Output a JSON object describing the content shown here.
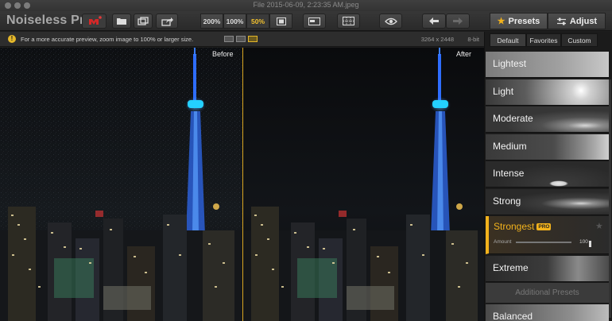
{
  "window": {
    "title": "File 2015-06-09, 2:23:35 AM.jpeg"
  },
  "toolbar": {
    "app_name": "Noiseless Pro",
    "zoom_buttons": [
      "200%",
      "100%",
      "50%"
    ],
    "active_zoom": "50%",
    "presets_tab": "Presets",
    "adjust_tab": "Adjust"
  },
  "infobar": {
    "message": "For a more accurate preview, zoom image to 100% or larger size.",
    "dimensions": "3264 x 2448",
    "bit_depth": "8-bit"
  },
  "preview": {
    "before_label": "Before",
    "after_label": "After"
  },
  "panel": {
    "tabs": [
      "Default",
      "Favorites",
      "Custom"
    ],
    "active_tab": "Default",
    "presets": [
      "Lightest",
      "Light",
      "Moderate",
      "Medium",
      "Intense",
      "Strong",
      "Strongest",
      "Extreme"
    ],
    "selected_preset": "Strongest",
    "pro_badge": "PRO",
    "amount_label": "Amount",
    "amount_value": "100",
    "additional_header": "Additional Presets",
    "additional_presets": [
      "Balanced"
    ]
  },
  "colors": {
    "accent": "#f2b21c",
    "tower_light": "#2e8dff",
    "ring": "#22d6ff"
  }
}
